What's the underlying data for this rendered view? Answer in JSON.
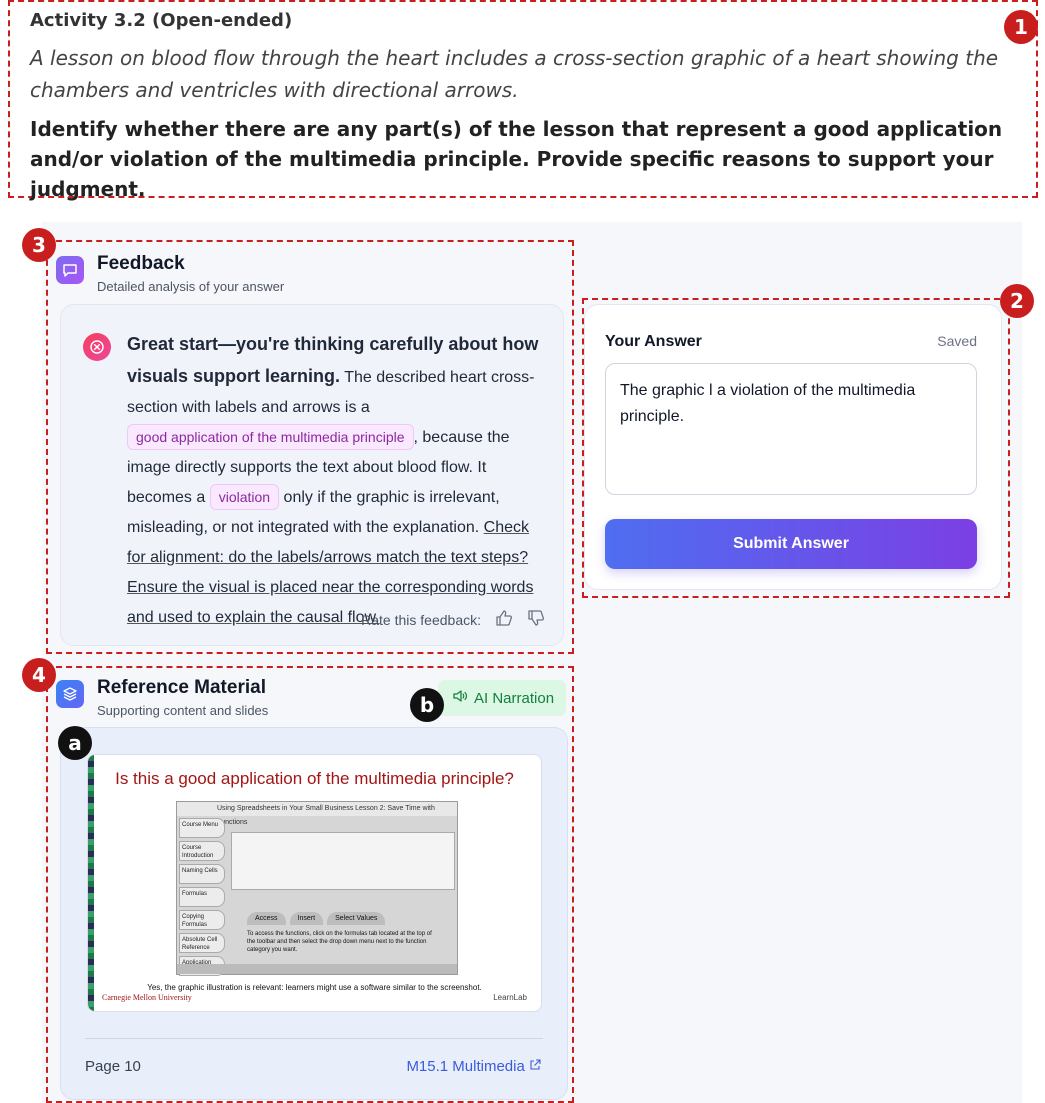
{
  "activity": {
    "title": "Activity 3.2 (Open-ended)",
    "description": "A lesson on blood flow through the heart includes a cross-section graphic of a heart showing the chambers and ventricles with directional arrows.",
    "question": "Identify whether there are any part(s) of the lesson that represent a good application and/or violation of the multimedia principle. Provide specific reasons to support your judgment."
  },
  "badges": {
    "one": "1",
    "two": "2",
    "three": "3",
    "four": "4",
    "a": "a",
    "b": "b"
  },
  "feedback": {
    "title": "Feedback",
    "subtitle": "Detailed analysis of your answer",
    "lead": "Great start—you're thinking carefully about how visuals support learning.",
    "t1": " The described heart cross-section with labels and arrows is a ",
    "hl1": "good application of the multimedia principle",
    "t2": ", because the image directly supports the text about blood flow. It becomes a ",
    "hl2": "violation",
    "t3": " only if the graphic is irrelevant, misleading, or not integrated with the explanation. ",
    "tip": "Check for alignment: do the labels/arrows match the text steps? Ensure the visual is placed near the corresponding words and used to explain the causal flow.",
    "rate_label": "Rate this feedback:"
  },
  "answer": {
    "title": "Your Answer",
    "status": "Saved",
    "text": "The graphic l a violation of the multimedia principle.",
    "submit_label": "Submit Answer"
  },
  "reference": {
    "title": "Reference Material",
    "subtitle": "Supporting content and slides",
    "narration_label": "AI Narration",
    "slide": {
      "title": "Is this a good application of the multimedia principle?",
      "shot_header": "Using Spreadsheets in Your Small Business     Lesson 2: Save Time with Functions",
      "menu": [
        "Course Menu",
        "Course Introduction",
        "Naming Cells",
        "Formulas",
        "Copying Formulas",
        "Absolute Cell Reference",
        "Application Case Study"
      ],
      "tabs": [
        "Access",
        "Insert",
        "Select Values"
      ],
      "shot_text": "To access the functions, click on the formulas tab located at the top of the toolbar and then select the drop down menu next to the function category you want.",
      "caption": "Yes, the graphic illustration is relevant: learners might use a software similar to the screenshot.",
      "institution": "Carnegie Mellon University",
      "lab": "LearnLab"
    },
    "page_label": "Page 10",
    "module_link": "M15.1 Multimedia"
  },
  "colors": {
    "annotation_red": "#c81e1e",
    "accent_blue": "#4f6ef0",
    "accent_purple": "#7b3fe4",
    "narration_green": "#15803d"
  }
}
